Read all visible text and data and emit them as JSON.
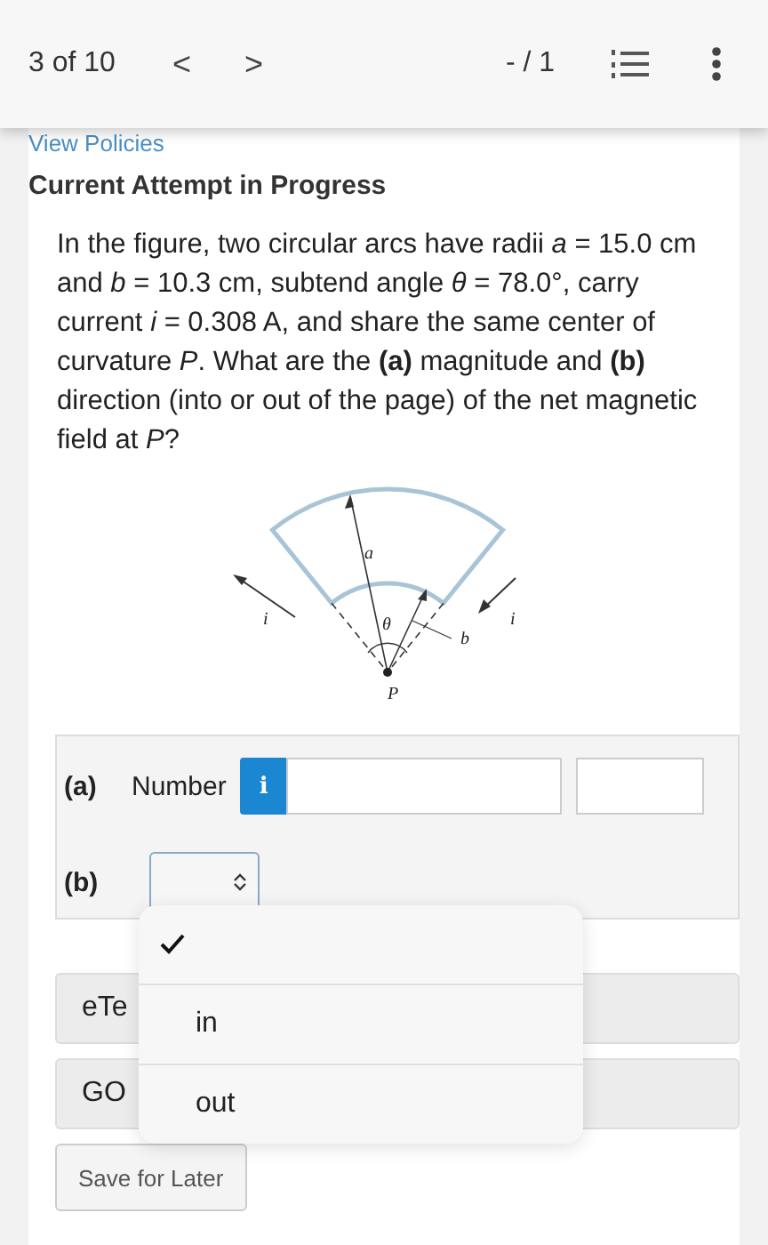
{
  "header": {
    "position": "3 of 10",
    "prev": "<",
    "next": ">",
    "score": "- / 1"
  },
  "policies_link": "View Policies",
  "attempt_title": "Current Attempt in Progress",
  "question": "In the figure, two circular arcs have radii *a* = 15.0 cm and *b* = 10.3 cm, subtend angle *θ* = 78.0°, carry current *i* = 0.308 A, and share the same center of curvature *P*. What are the **(a)** magnitude and **(b)** direction (into or out of the page) of the net magnetic field at *P*?",
  "figure": {
    "labels": [
      "a",
      "θ",
      "b",
      "i",
      "i",
      "P"
    ]
  },
  "part_a": {
    "label": "(a)",
    "field_type": "Number",
    "info": "i"
  },
  "part_b": {
    "label": "(b)",
    "menu": {
      "expanded": true,
      "options": [
        {
          "selected": true
        },
        {
          "label": "in",
          "selected": false
        },
        {
          "label": "out",
          "selected": false
        }
      ]
    }
  },
  "buttons": [
    "eTe",
    "GO"
  ],
  "save_button": "Save for Later"
}
